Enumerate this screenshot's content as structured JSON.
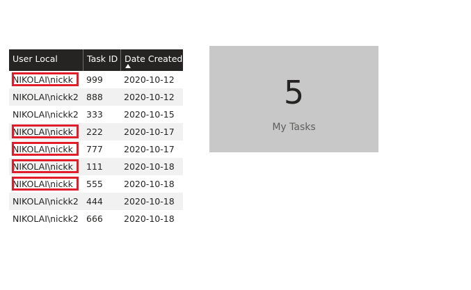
{
  "table": {
    "columns": [
      {
        "label": "User Local"
      },
      {
        "label": "Task ID"
      },
      {
        "label": "Date Created",
        "sorted": "ascending"
      }
    ],
    "rows": [
      {
        "user": "NIKOLAI\\nickk",
        "task_id": "999",
        "date": "2020-10-12",
        "highlighted": true
      },
      {
        "user": "NIKOLAI\\nickk2",
        "task_id": "888",
        "date": "2020-10-12",
        "highlighted": false
      },
      {
        "user": "NIKOLAI\\nickk2",
        "task_id": "333",
        "date": "2020-10-15",
        "highlighted": false
      },
      {
        "user": "NIKOLAI\\nickk",
        "task_id": "222",
        "date": "2020-10-17",
        "highlighted": true
      },
      {
        "user": "NIKOLAI\\nickk",
        "task_id": "777",
        "date": "2020-10-17",
        "highlighted": true
      },
      {
        "user": "NIKOLAI\\nickk",
        "task_id": "111",
        "date": "2020-10-18",
        "highlighted": true
      },
      {
        "user": "NIKOLAI\\nickk",
        "task_id": "555",
        "date": "2020-10-18",
        "highlighted": true
      },
      {
        "user": "NIKOLAI\\nickk2",
        "task_id": "444",
        "date": "2020-10-18",
        "highlighted": false
      },
      {
        "user": "NIKOLAI\\nickk2",
        "task_id": "666",
        "date": "2020-10-18",
        "highlighted": false
      }
    ]
  },
  "card": {
    "value": "5",
    "label": "My Tasks"
  },
  "colors": {
    "header_bg": "#252423",
    "header_text": "#ffffff",
    "alt_row_bg": "#f1f1f1",
    "highlight": "#e01e2b",
    "card_bg": "#c8c8c8"
  }
}
